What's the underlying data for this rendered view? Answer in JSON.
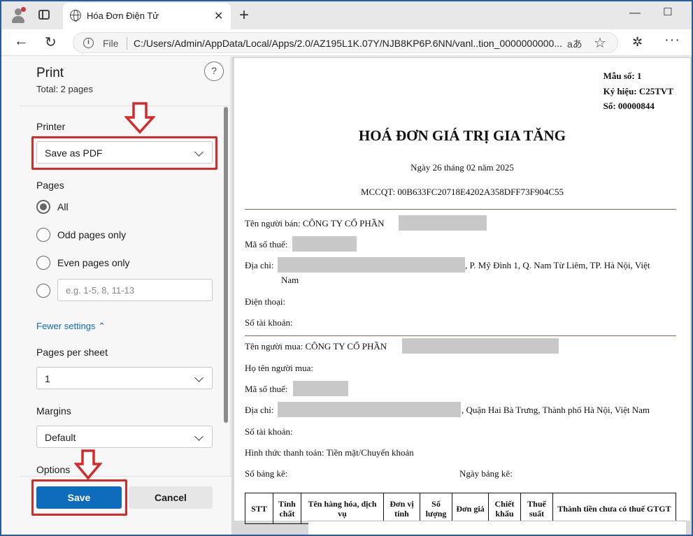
{
  "browser": {
    "tab_title": "Hóa Đơn Điện Tử",
    "file_label": "File",
    "url": "C:/Users/Admin/AppData/Local/Apps/2.0/AZ195L1K.07Y/NJB8KP6P.6NN/vanl..tion_0000000000...",
    "read_aloud": "aあ",
    "icons": [
      "profile-icon",
      "tab-actions-icon",
      "globe-icon",
      "close-icon",
      "new-tab-icon",
      "minimize-icon",
      "maximize-icon",
      "back-icon",
      "refresh-icon",
      "info-icon",
      "star-icon",
      "extensions-icon",
      "menu-icon"
    ]
  },
  "print": {
    "title": "Print",
    "total": "Total: 2 pages",
    "help": "?",
    "printer_label": "Printer",
    "printer_value": "Save as PDF",
    "pages_label": "Pages",
    "pages_options": [
      "All",
      "Odd pages only",
      "Even pages only"
    ],
    "pages_selected": "All",
    "custom_placeholder": "e.g. 1-5, 8, 11-13",
    "fewer_settings": "Fewer settings ⌃",
    "pages_per_sheet_label": "Pages per sheet",
    "pages_per_sheet_value": "1",
    "margins_label": "Margins",
    "margins_value": "Default",
    "options_label": "Options",
    "save": "Save",
    "cancel": "Cancel",
    "annotation_color": "#d62a2a"
  },
  "invoice": {
    "mau_so": "Mẫu số: 1",
    "ky_hieu": "Ký hiệu: C25TVT",
    "so": "Số: 00000844",
    "title": "HOÁ ĐƠN GIÁ TRỊ GIA TĂNG",
    "date": "Ngày 26 tháng 02 năm 2025",
    "mccqt": "MCCQT: 00B633FC20718E4202A358DFF73F904C55",
    "seller_name": "Tên người bán:  CÔNG TY CỔ PHẦN",
    "seller_tax": "Mã số thuế:",
    "seller_addr": "Địa chỉ:",
    "seller_addr_tail": ", P. Mỹ Đình 1, Q. Nam Từ Liêm, TP. Hà Nội, Việt",
    "seller_addr_tail2": "Nam",
    "seller_phone": "Điện thoại:",
    "seller_account": "Số tài khoản:",
    "buyer_name": "Tên người mua:  CÔNG TY CỔ PHẦN",
    "buyer_person": "Họ tên người mua:",
    "buyer_tax": "Mã số thuế:",
    "buyer_addr": "Địa chỉ:",
    "buyer_addr_tail": ", Quận Hai Bà Trưng, Thành phố Hà Nội, Việt Nam",
    "buyer_account": "Số tài khoản:",
    "payment": "Hình thức thanh toán:  Tiền mặt/Chuyển khoản",
    "bang_ke": "Số bảng kê:",
    "ngay_bang_ke": "Ngày bảng kê:",
    "table_headers": [
      "STT",
      "Tính chất",
      "Tên hàng hóa, dịch vụ",
      "Đơn vị tính",
      "Số lượng",
      "Đơn giá",
      "Chiết khấu",
      "Thuế suất",
      "Thành tiền chưa có thuế GTGT"
    ]
  }
}
